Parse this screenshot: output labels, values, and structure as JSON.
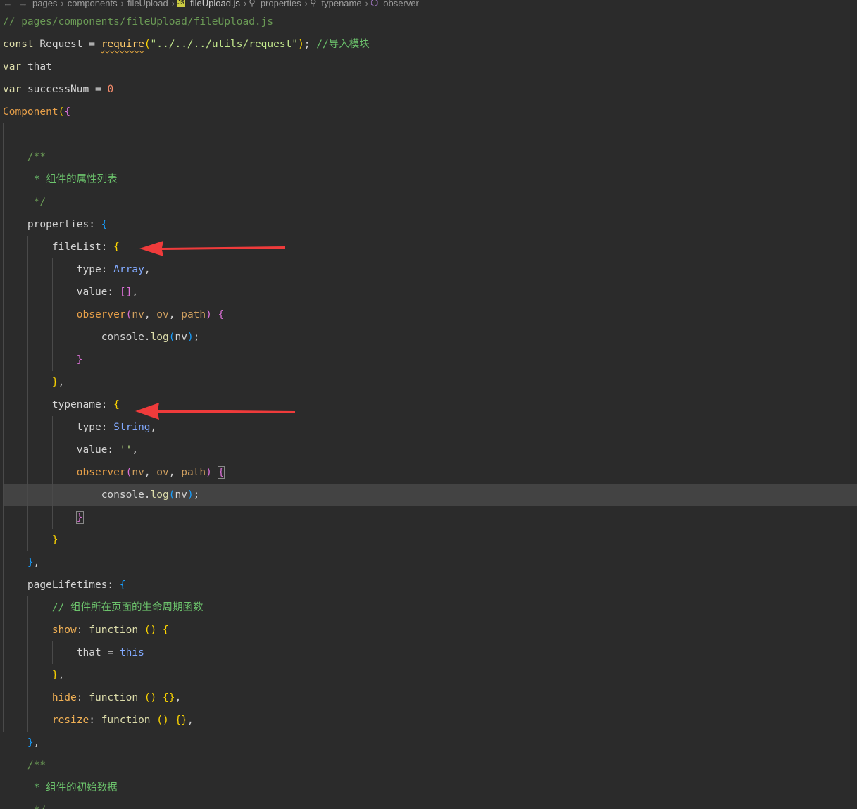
{
  "breadcrumb": {
    "items": [
      "pages",
      "components",
      "fileUpload",
      "fileUpload.js",
      "properties",
      "typename",
      "observer"
    ],
    "back_icon": "arrow-left-icon",
    "forward_icon": "arrow-right-icon",
    "file_icon_label": "JS"
  },
  "code": {
    "l1": "// pages/components/fileUpload/fileUpload.js",
    "l2_kw": "const",
    "l2_name": "Request",
    "l2_eq": "=",
    "l2_fn": "require",
    "l2_str": "\"../../../utils/request\"",
    "l2_comment": "//导入模块",
    "l3_kw": "var",
    "l3_name": "that",
    "l4_kw": "var",
    "l4_name": "successNum",
    "l4_eq": "=",
    "l4_num": "0",
    "l5_fn": "Component",
    "l7": "/**",
    "l8": "* 组件的属性列表",
    "l9": "*/",
    "l10_prop": "properties",
    "l11_prop": "fileList",
    "l12_prop": "type",
    "l12_val": "Array",
    "l13_prop": "value",
    "l13_val": "[]",
    "l14_fn": "observer",
    "l14_p1": "nv",
    "l14_p2": "ov",
    "l14_p3": "path",
    "l15_obj": "console",
    "l15_fn": "log",
    "l15_arg": "nv",
    "l18_prop": "typename",
    "l19_prop": "type",
    "l19_val": "String",
    "l20_prop": "value",
    "l20_val": "''",
    "l21_fn": "observer",
    "l21_p1": "nv",
    "l21_p2": "ov",
    "l21_p3": "path",
    "l22_obj": "console",
    "l22_fn": "log",
    "l22_arg": "nv",
    "l26_prop": "pageLifetimes",
    "l27": "// 组件所在页面的生命周期函数",
    "l28_prop": "show",
    "l28_kw": "function",
    "l29_name": "that",
    "l29_eq": "=",
    "l29_this": "this",
    "l31_prop": "hide",
    "l31_kw": "function",
    "l32_prop": "resize",
    "l32_kw": "function",
    "l34": "/**",
    "l35": "* 组件的初始数据",
    "l36": "*/"
  },
  "annotations": {
    "arrow_color": "#ef3b3b",
    "arrow_icon": "red-arrow-icon"
  }
}
